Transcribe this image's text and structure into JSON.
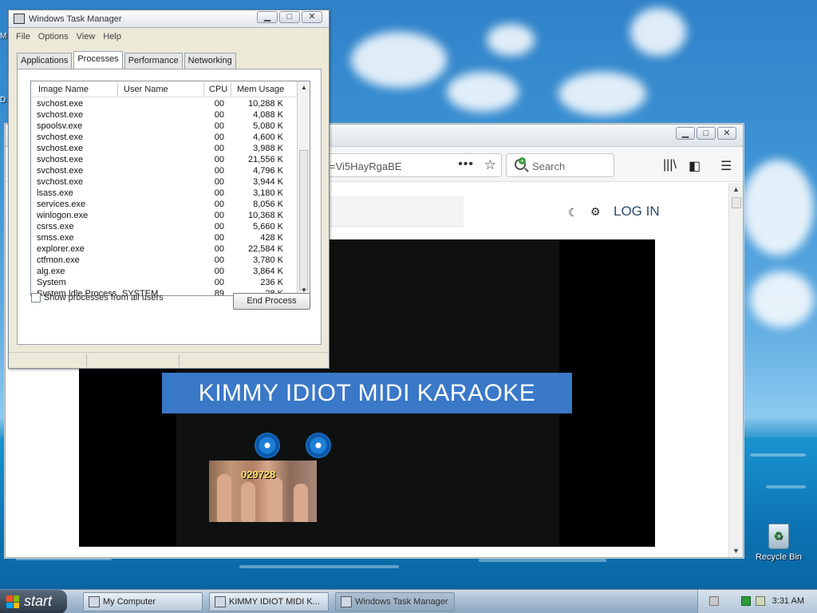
{
  "desktop": {
    "recycle_bin_label": "Recycle Bin",
    "left_stub_1": "M",
    "left_stub_2": "D"
  },
  "task_manager": {
    "title": "Windows Task Manager",
    "menu": [
      "File",
      "Options",
      "View",
      "Help"
    ],
    "tabs": [
      "Applications",
      "Processes",
      "Performance",
      "Networking"
    ],
    "active_tab": "Processes",
    "columns": {
      "image": "Image Name",
      "user": "User Name",
      "cpu": "CPU",
      "mem": "Mem Usage"
    },
    "processes": [
      {
        "name": "svchost.exe",
        "user": "",
        "cpu": "00",
        "mem": "10,288 K"
      },
      {
        "name": "svchost.exe",
        "user": "",
        "cpu": "00",
        "mem": "4,088 K"
      },
      {
        "name": "spoolsv.exe",
        "user": "",
        "cpu": "00",
        "mem": "5,080 K"
      },
      {
        "name": "svchost.exe",
        "user": "",
        "cpu": "00",
        "mem": "4,600 K"
      },
      {
        "name": "svchost.exe",
        "user": "",
        "cpu": "00",
        "mem": "3,988 K"
      },
      {
        "name": "svchost.exe",
        "user": "",
        "cpu": "00",
        "mem": "21,556 K"
      },
      {
        "name": "svchost.exe",
        "user": "",
        "cpu": "00",
        "mem": "4,796 K"
      },
      {
        "name": "svchost.exe",
        "user": "",
        "cpu": "00",
        "mem": "3,944 K"
      },
      {
        "name": "lsass.exe",
        "user": "",
        "cpu": "00",
        "mem": "3,180 K"
      },
      {
        "name": "services.exe",
        "user": "",
        "cpu": "00",
        "mem": "8,056 K"
      },
      {
        "name": "winlogon.exe",
        "user": "",
        "cpu": "00",
        "mem": "10,368 K"
      },
      {
        "name": "csrss.exe",
        "user": "",
        "cpu": "00",
        "mem": "5,660 K"
      },
      {
        "name": "smss.exe",
        "user": "",
        "cpu": "00",
        "mem": "428 K"
      },
      {
        "name": "explorer.exe",
        "user": "",
        "cpu": "00",
        "mem": "22,584 K"
      },
      {
        "name": "ctfmon.exe",
        "user": "",
        "cpu": "00",
        "mem": "3,780 K"
      },
      {
        "name": "alg.exe",
        "user": "",
        "cpu": "00",
        "mem": "3,864 K"
      },
      {
        "name": "System",
        "user": "",
        "cpu": "00",
        "mem": "236 K"
      },
      {
        "name": "System Idle Process",
        "user": "SYSTEM",
        "cpu": "89",
        "mem": "28 K"
      }
    ],
    "show_all_label": "Show processes from all users",
    "end_process_label": "End Process"
  },
  "browser": {
    "url_fragment": "=Vi5HayRgaBE",
    "url_dots": "•••",
    "search_placeholder": "Search",
    "login_label": "LOG IN",
    "video_title": "KIMMY IDIOT MIDI KARAOKE",
    "thumb_number": "029728"
  },
  "taskbar": {
    "start_label": "start",
    "items": [
      "My Computer",
      "KIMMY IDIOT MIDI K...",
      "Windows Task Manager"
    ],
    "clock": "3:31 AM"
  }
}
